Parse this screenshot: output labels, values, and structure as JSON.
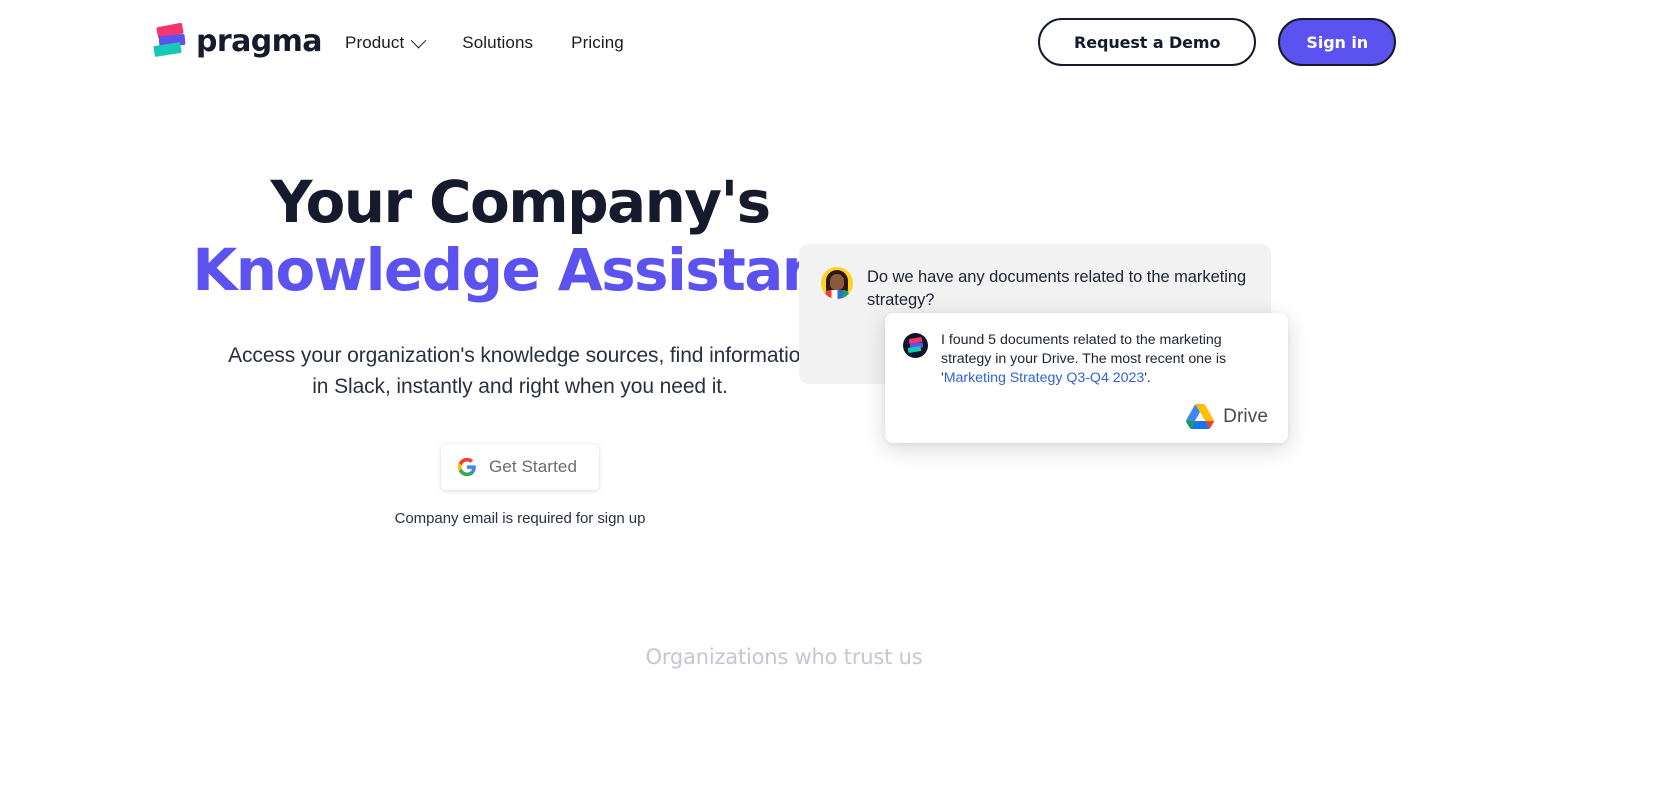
{
  "brand": {
    "name": "pragma",
    "logo_colors": [
      "#f6366a",
      "#5b52f0",
      "#17c9b5"
    ]
  },
  "nav": {
    "items": [
      {
        "label": "Product",
        "has_dropdown": true
      },
      {
        "label": "Solutions",
        "has_dropdown": false
      },
      {
        "label": "Pricing",
        "has_dropdown": false
      }
    ]
  },
  "header_actions": {
    "demo_label": "Request a Demo",
    "signin_label": "Sign in",
    "signin_bg": "#5b52f0"
  },
  "hero": {
    "title_line1": "Your Company's",
    "title_line2": "Knowledge Assistant",
    "accent_color": "#5b52f0",
    "subtitle": "Access your organization's knowledge sources, find information in Slack, instantly and right when you need it.",
    "cta_label": "Get Started",
    "cta_icon": "google-g-icon",
    "cta_note": "Company email is required for sign up"
  },
  "chat": {
    "question": {
      "avatar": "user-avatar-photo",
      "text": "Do we have any documents related to the marketing strategy?"
    },
    "answer": {
      "avatar": "pragma-bot-avatar",
      "text_before": "I found 5 documents related to the marketing strategy in your Drive. The most recent one is '",
      "link_text": "Marketing Strategy Q3-Q4 2023",
      "text_after": "'.",
      "link_color": "#2f63d8",
      "source_label": "Drive",
      "source_icon": "google-drive-icon"
    }
  },
  "trust": {
    "heading": "Organizations who trust us"
  }
}
